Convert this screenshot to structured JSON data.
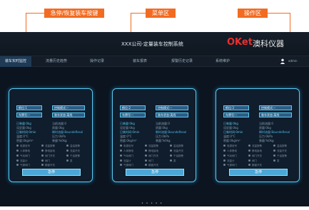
{
  "annotations": {
    "emergency_label": "急停/恢复装车按键",
    "menu_label": "菜单区",
    "operation_label": "操作区"
  },
  "app": {
    "title": "XXX公司-定量装车控制系统",
    "logo_text": "OKet",
    "logo_cn": "澳科仪器",
    "user_label": "admin"
  },
  "menu": {
    "tabs": [
      "装车实时监控",
      "流量历史趋势",
      "操作记录",
      "装车报表",
      "报警历史记录",
      "系统维护"
    ]
  },
  "panels": [
    {
      "field1": "鹤位:1",
      "field2": "控制模式:--",
      "field3": "车牌号:--",
      "field4": "装车状态:离线",
      "stats": [
        [
          "已装量:0kg",
          "当前流量:0"
        ],
        [
          "设定量:0kg",
          "质量:0kg"
        ],
        [
          "已装时间:0min",
          "瞬时流量:BoundeResol"
        ],
        [
          "温度:0°C",
          "压力:0kPa"
        ],
        [
          "密度:0kg/m³",
          "装量:%0kg"
        ]
      ],
      "indicators": [
        [
          "电源信号",
          "流量报警",
          "溢油报警"
        ],
        [
          "人体静电",
          "静电接地",
          "流量开关"
        ],
        [
          "气动阀门",
          "阀门开关",
          "干油报警"
        ],
        [
          "流量计",
          "阀门",
          "泵"
        ],
        [
          "气源阀门",
          "鹤管开关",
          ""
        ]
      ],
      "stop_label": "急停"
    },
    {
      "field1": "鹤位:2",
      "field2": "控制模式:--",
      "field3": "车牌号:--",
      "field4": "装车状态:离线",
      "stats": [
        [
          "已装量:0kg",
          "当前流量:0"
        ],
        [
          "设定量:0kg",
          "质量:0kg"
        ],
        [
          "已装时间:0min",
          "瞬时流量:BoundeResol"
        ],
        [
          "温度:0°C",
          "压力:0kPa"
        ],
        [
          "密度:0kg/m³",
          "装量:%0kg"
        ]
      ],
      "indicators": [
        [
          "电源信号",
          "流量报警",
          "溢油报警"
        ],
        [
          "人体静电",
          "静电接地",
          "流量开关"
        ],
        [
          "气动阀门",
          "阀门开关",
          "干油报警"
        ],
        [
          "流量计",
          "阀门",
          "泵"
        ],
        [
          "气源阀门",
          "鹤管开关",
          ""
        ]
      ],
      "stop_label": "急停"
    },
    {
      "field1": "鹤位:3",
      "field2": "控制模式:--",
      "field3": "车牌号:--",
      "field4": "装车状态:离线",
      "stats": [
        [
          "已装量:0kg",
          "当前流量:0"
        ],
        [
          "设定量:0kg",
          "质量:0kg"
        ],
        [
          "已装时间:0min",
          "瞬时流量:BoundeResol"
        ],
        [
          "温度:0°C",
          "压力:0kPa"
        ],
        [
          "密度:0kg/m³",
          "装量:%0kg"
        ]
      ],
      "indicators": [
        [
          "电源信号",
          "流量报警",
          "溢油报警"
        ],
        [
          "人体静电",
          "静电接地",
          "流量开关"
        ],
        [
          "气动阀门",
          "阀门开关",
          "干油报警"
        ],
        [
          "流量计",
          "阀门",
          "泵"
        ],
        [
          "气源阀门",
          "鹤管开关",
          ""
        ]
      ],
      "stop_label": "急停"
    }
  ],
  "pager": "• • • • •",
  "colors": {
    "accent": "#f26b21",
    "panel_border": "#5cc9f0",
    "background": "#0c1420"
  }
}
